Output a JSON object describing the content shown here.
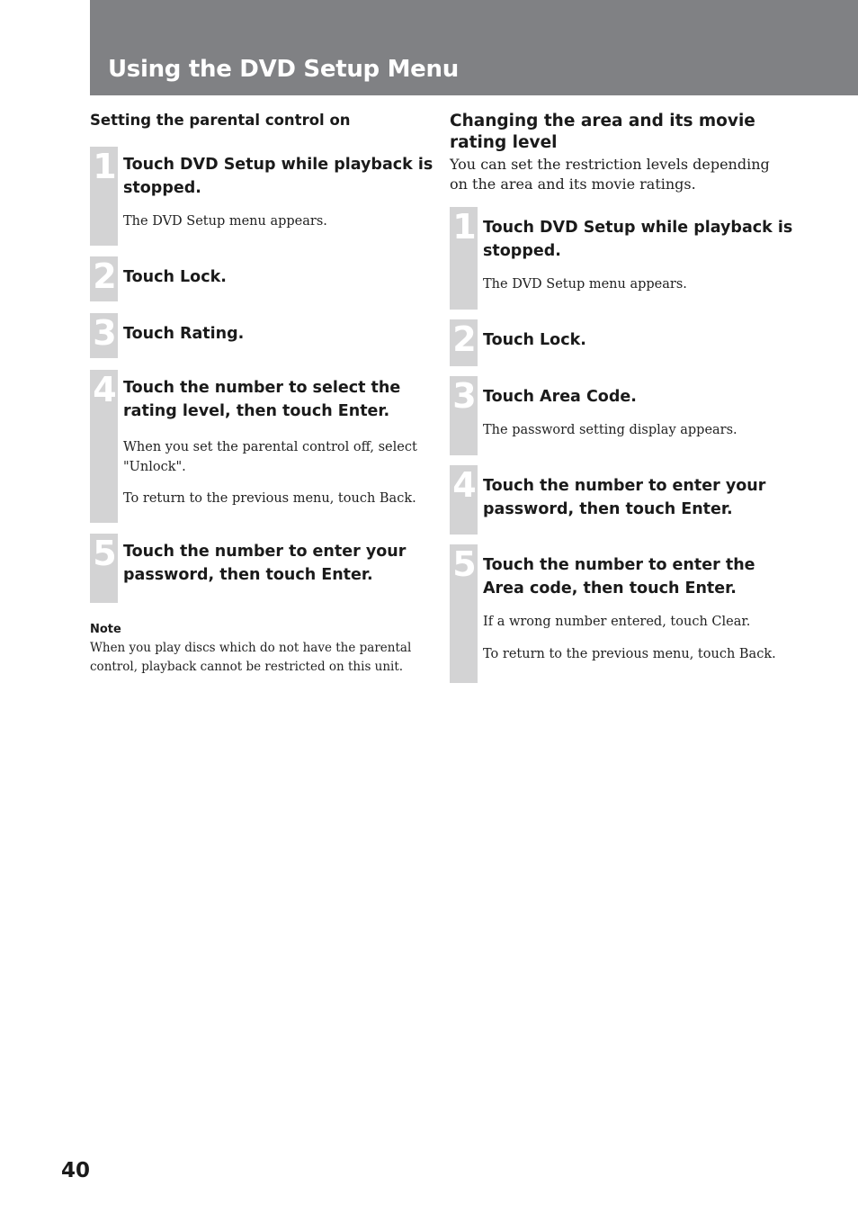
{
  "header": {
    "title": "Using the DVD Setup Menu",
    "band_color": "#808184"
  },
  "left_section": {
    "heading": "Setting the parental control on",
    "steps": [
      {
        "number": "1",
        "title": "Touch DVD Setup while playback is stopped.",
        "details": [
          "The DVD Setup menu appears."
        ]
      },
      {
        "number": "2",
        "title": "Touch Lock.",
        "details": []
      },
      {
        "number": "3",
        "title": "Touch Rating.",
        "details": []
      },
      {
        "number": "4",
        "title": "Touch the number to select the rating level, then touch Enter.",
        "details": [
          "When you set the parental control off, select \"Unlock\".",
          "To return to the previous menu, touch Back."
        ]
      },
      {
        "number": "5",
        "title": "Touch the number to enter your password, then touch Enter.",
        "details": []
      }
    ],
    "note": {
      "label": "Note",
      "text": "When you play discs which do not have the parental control, playback cannot be restricted on this unit."
    }
  },
  "right_section": {
    "heading": "Changing the area and its movie rating level",
    "intro": "You can set the restriction levels depending on the area and its movie ratings.",
    "steps": [
      {
        "number": "1",
        "title": "Touch DVD Setup while playback is stopped.",
        "details": [
          "The DVD Setup menu appears."
        ]
      },
      {
        "number": "2",
        "title": "Touch Lock.",
        "details": []
      },
      {
        "number": "3",
        "title": "Touch Area Code.",
        "details": [
          "The password setting display appears."
        ]
      },
      {
        "number": "4",
        "title": "Touch the number to enter your password, then touch Enter.",
        "details": []
      },
      {
        "number": "5",
        "title": "Touch the number to enter the Area code, then touch Enter.",
        "details": [
          "If a wrong number entered, touch Clear.",
          "To return to the previous menu, touch Back."
        ]
      }
    ]
  },
  "footer": {
    "page_number": "40"
  }
}
